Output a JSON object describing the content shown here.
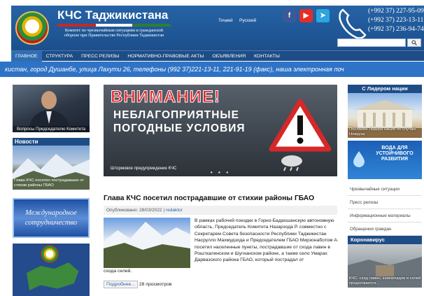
{
  "header": {
    "title": "КЧС Таджикистана",
    "subtitle": "Комитет по чрезвычайным ситуациям и гражданской обороне при Правительстве Республики Таджикистан",
    "languages": [
      "Тоҷикӣ",
      "Русский"
    ],
    "social": [
      {
        "name": "facebook-icon",
        "label": "f",
        "color": "#3b5998"
      },
      {
        "name": "youtube-icon",
        "label": "▶",
        "color": "#e52d27"
      },
      {
        "name": "telegram-icon",
        "label": "➤",
        "color": "#2ca5e0"
      }
    ],
    "phones": [
      "(+992 37) 227-95-09",
      "(+992 37) 223-13-11",
      "(+992 37) 236-94-74"
    ],
    "search_placeholder": "",
    "search_button": "Q"
  },
  "nav": [
    "ГЛАВНОЕ",
    "СТРУКТУРА",
    "ПРЕСС РЕЛИЗЫ",
    "НОРМАТИВНО-ПРАВОВЫЕ АКТЫ",
    "ОБЪЯВЛЕНИЯ",
    "КОНТАКТЫ"
  ],
  "ticker": "кистан, город Душанбе, улица Лахути 26, телефоны (992 37)221-13-11, 221-91-19 (факс), наша электронная поч",
  "left": {
    "minister_caption": "Вопросы Председателю Комитета",
    "news_title": "Новости",
    "news_caption": "Глава КЧС посетил пострадавшие от стихии районы ГБАО",
    "banner_text": "Международное сотрудничество"
  },
  "hero": {
    "headline": "ВНИМАНИЕ!",
    "text": "НЕБЛАГОПРИЯТНЫЕ ПОГОДНЫЕ УСЛОВИЯ",
    "caption": "Штормовое предупреждение КЧС"
  },
  "article": {
    "title": "Глава КЧС посетил пострадавшие от стихии районы ГБАО",
    "published": "Опубликовано: 28/03/2022",
    "author": "redaktor",
    "body": "В рамках рабочей поездки в Горно-Бадахшанскую автономную область, Председатель Комитета Назарзода Р. совместно с Секретарем Совета безопасности Республики Таджикистан Насрулло Махмудзода и Председателем ГБАО Мирзонаботом А. посетил населенные пункты, пострадавшие от схода лавин в Рошткалинском и Шугнанском районе, а также село Умарах Дарвазского района ГБАО, который пострадал от",
    "body_tail": "схода селей.",
    "more_button": "Подробнее...",
    "views": "28 просмотров"
  },
  "right": {
    "leader_title": "С Лидером нации",
    "leader_caption": "Послание Лидера нации по случаю Новруза",
    "sdg_text": "ВОДА ДЛЯ УСТОЙЧИВОГО РАЗВИТИЯ",
    "links": [
      "Чрезвычайные ситуации",
      "Пресс релизы",
      "Информационные материалы",
      "Обращения граждан"
    ],
    "corona_title": "Коронавирус",
    "corona_caption": "КЧС: сход лавин, камнепадов и селей продолжается..."
  }
}
